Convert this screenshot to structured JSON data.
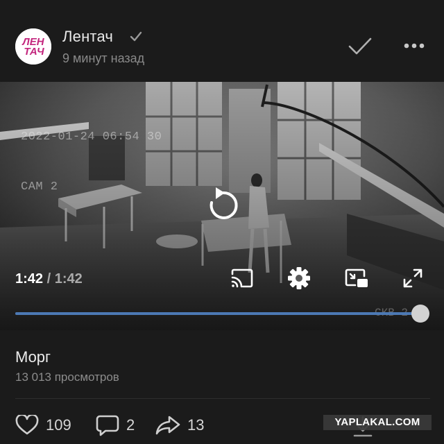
{
  "post": {
    "channel_name": "Лентач",
    "channel_logo_text": [
      "ЛЕН",
      "ТАЧ"
    ],
    "time_ago": "9 минут назад",
    "avatar_colors": {
      "logo": "#c3257d",
      "background": "#ffffff"
    }
  },
  "player": {
    "cam_stamp": [
      "2022-01-24 06:54 30",
      "CAM 2"
    ],
    "current_time": "1:42",
    "separator": " / ",
    "duration": "1:42",
    "progress_fraction": 1.0,
    "cam_label": "СКВ 2",
    "accent_color": "#4c79b4",
    "controls": [
      "replay-icon",
      "cast-icon",
      "settings-icon",
      "picture-in-picture-icon",
      "fullscreen-icon"
    ]
  },
  "video": {
    "title": "Морг",
    "views": "13 013 просмотров"
  },
  "actions": {
    "likes": "109",
    "comments": "2",
    "shares": "13"
  },
  "watermark": "YAPLAKAL.COM"
}
